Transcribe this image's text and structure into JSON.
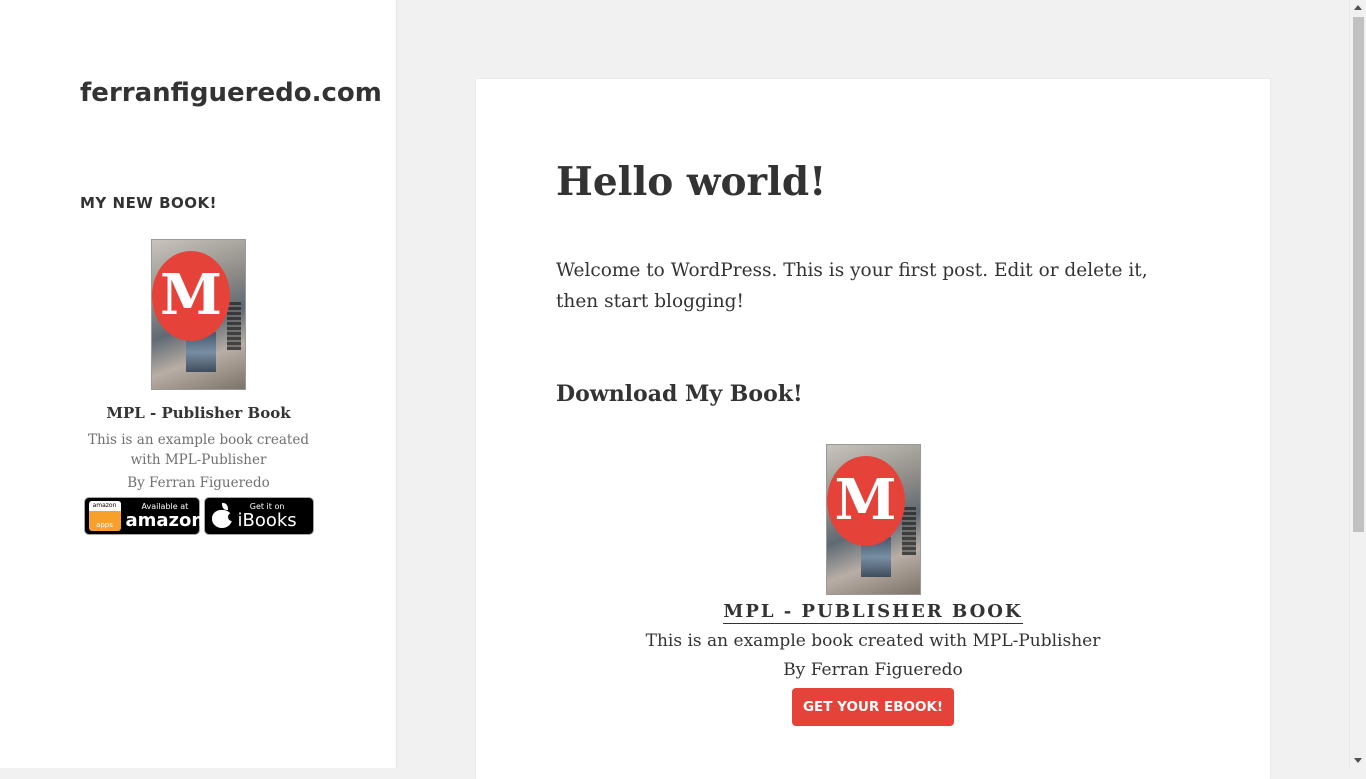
{
  "site": {
    "title": "ferranfigueredo.com"
  },
  "sidebar": {
    "widget_title": "MY NEW BOOK!",
    "book": {
      "cover_letter": "M",
      "title": "MPL - Publisher Book",
      "description": "This is an example book created with MPL-Publisher",
      "author": "By Ferran Figueredo"
    },
    "badges": {
      "amazon": {
        "apps_top": "amazon",
        "apps_bottom": "apps",
        "small": "Available at",
        "big": "amazon"
      },
      "ibooks": {
        "small": "Get it on",
        "big": "iBooks"
      }
    }
  },
  "post": {
    "title": "Hello world!",
    "body": "Welcome to WordPress. This is your first post. Edit or delete it, then start blogging!",
    "download_heading": "Download My Book!",
    "book": {
      "cover_letter": "M",
      "title": "MPL - PUBLISHER BOOK",
      "description": "This is an example book created with MPL-Publisher",
      "author": "By Ferran Figueredo",
      "button_label": "GET YOUR EBOOK!"
    }
  },
  "colors": {
    "accent": "#e5423a",
    "text": "#333333",
    "muted_text": "#707070",
    "page_background": "#f1f1f1"
  }
}
